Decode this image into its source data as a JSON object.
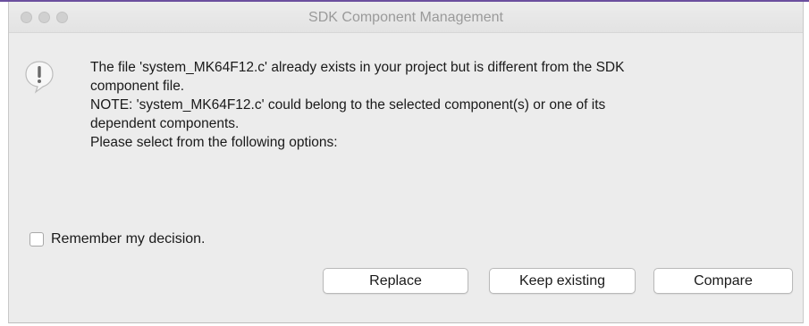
{
  "window": {
    "title": "SDK Component Management"
  },
  "dialog": {
    "icon": "alert-icon",
    "message_lines": [
      "The file 'system_MK64F12.c' already exists in your project but is different from the SDK",
      "component file.",
      "NOTE: 'system_MK64F12.c' could belong to the selected component(s) or one of its",
      "dependent components.",
      "Please select from the following options:"
    ],
    "remember_label": "Remember my decision.",
    "remember_checked": false
  },
  "buttons": {
    "replace": "Replace",
    "keep_existing": "Keep existing",
    "compare": "Compare"
  },
  "colors": {
    "window_bg": "#ececec",
    "accent_line": "#6b4f9e",
    "title_text": "#9a9a9a"
  }
}
